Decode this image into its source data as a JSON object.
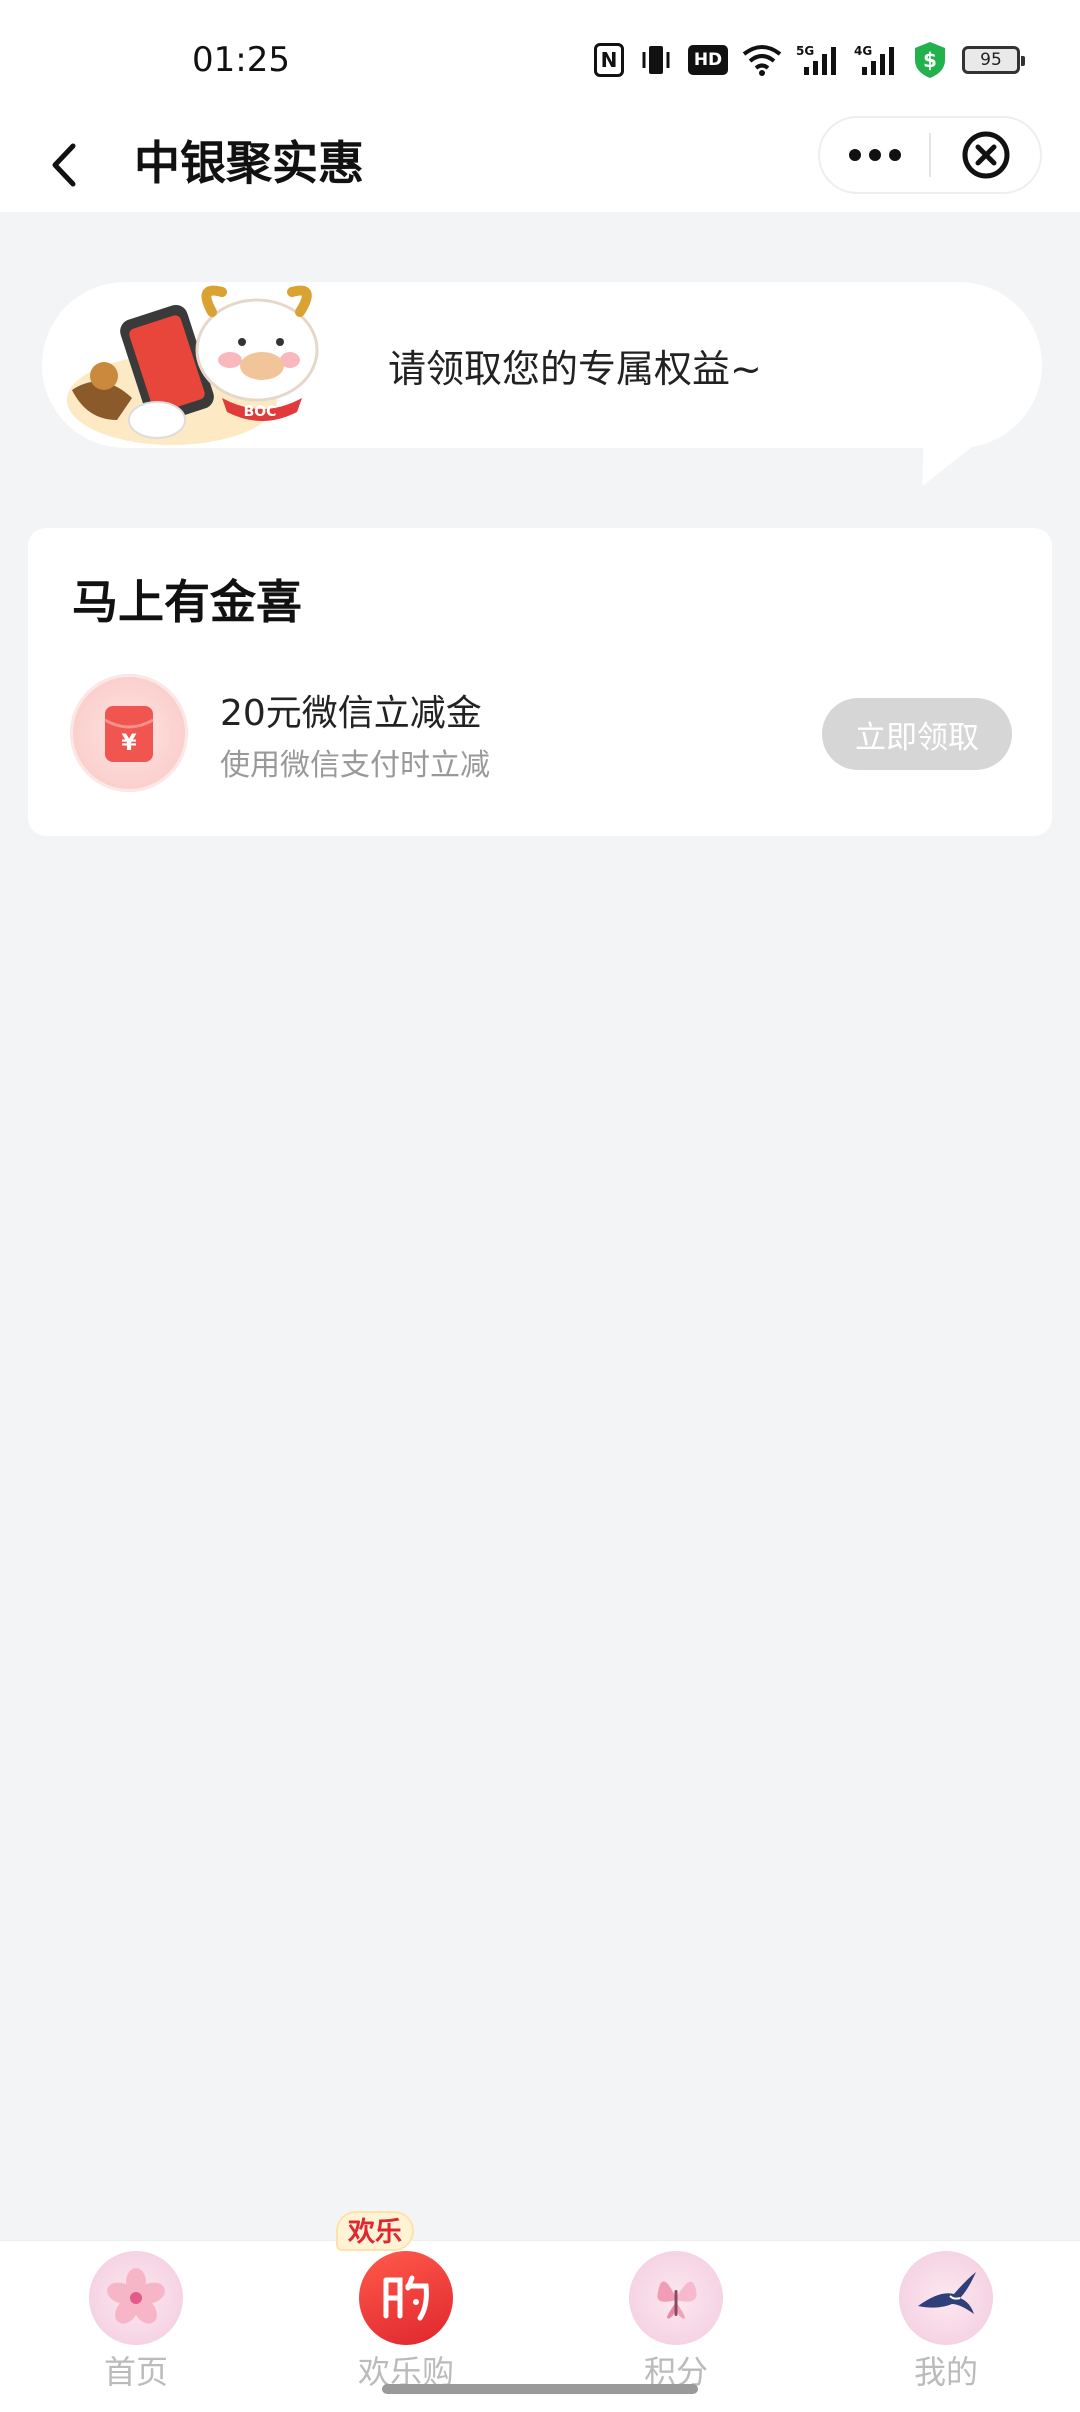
{
  "status_bar": {
    "time": "01:25",
    "battery": "95",
    "icons": [
      "nfc-icon",
      "vibrate-icon",
      "hd-icon",
      "wifi-icon",
      "signal-5g-icon",
      "signal-4g-icon",
      "security-shield-icon",
      "battery-icon"
    ],
    "hd_label": "HD",
    "net1": "5G",
    "net2": "4G"
  },
  "nav": {
    "title": "中银聚实惠",
    "back_icon": "chevron-left-icon",
    "more_icon": "more-dots-icon",
    "close_icon": "close-circle-icon"
  },
  "banner": {
    "text": "请领取您的专属权益~",
    "mascot_tag": "BOC"
  },
  "card": {
    "title": "马上有金喜",
    "coupon": {
      "name": "20元微信立减金",
      "desc": "使用微信支付时立减",
      "button": "立即领取",
      "icon_symbol": "¥"
    }
  },
  "tabs": [
    {
      "label": "首页",
      "icon": "flower-icon"
    },
    {
      "label": "欢乐购",
      "icon": "shopping-icon",
      "badge": "欢乐"
    },
    {
      "label": "积分",
      "icon": "butterfly-icon"
    },
    {
      "label": "我的",
      "icon": "swallow-icon"
    }
  ],
  "colors": {
    "background": "#f3f4f6",
    "disabled_button": "#d6d6d6",
    "accent_red": "#e8362d"
  }
}
